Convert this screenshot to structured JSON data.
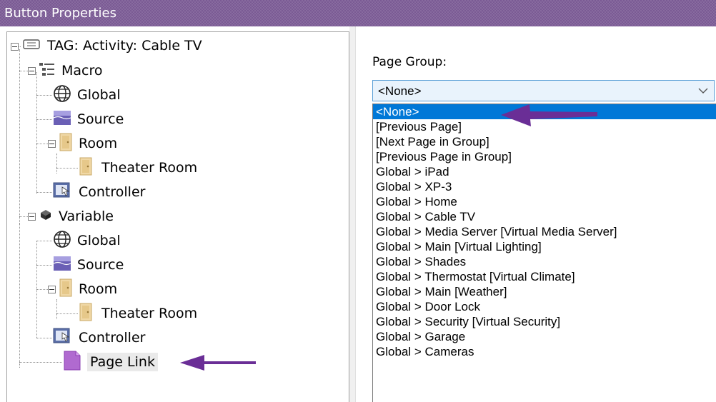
{
  "window": {
    "title": "Button Properties"
  },
  "tree": {
    "items": [
      {
        "label": "TAG: Activity: Cable TV",
        "icon": "tag-icon"
      },
      {
        "label": "Macro",
        "icon": "macro-list-icon"
      },
      {
        "label": "Global",
        "icon": "globe-icon"
      },
      {
        "label": "Source",
        "icon": "source-icon"
      },
      {
        "label": "Room",
        "icon": "room-door-icon"
      },
      {
        "label": "Theater Room",
        "icon": "room-door-icon"
      },
      {
        "label": "Controller",
        "icon": "controller-touch-icon"
      },
      {
        "label": "Variable",
        "icon": "variable-icon"
      },
      {
        "label": "Global",
        "icon": "globe-icon"
      },
      {
        "label": "Source",
        "icon": "source-icon"
      },
      {
        "label": "Room",
        "icon": "room-door-icon"
      },
      {
        "label": "Theater Room",
        "icon": "room-door-icon"
      },
      {
        "label": "Controller",
        "icon": "controller-touch-icon"
      },
      {
        "label": "Page Link",
        "icon": "page-link-icon",
        "selected": true
      }
    ]
  },
  "page_group": {
    "label": "Page Group:",
    "selected_value": "<None>",
    "options": [
      "<None>",
      "[Previous Page]",
      "[Next Page in Group]",
      "[Previous  Page in Group]",
      "Global > iPad",
      "Global > XP-3",
      "Global > Home",
      "Global > Cable TV",
      "Global > Media Server [Virtual Media Server]",
      "Global > Main [Virtual Lighting]",
      "Global > Shades",
      "Global > Thermostat [Virtual Climate]",
      "Global > Main [Weather]",
      "Global > Door Lock",
      "Global > Security [Virtual Security]",
      "Global > Garage",
      "Global > Cameras"
    ]
  },
  "colors": {
    "titlebar": "#7a5a94",
    "annotation_arrow": "#6a2e96",
    "selection": "#0078d7"
  }
}
